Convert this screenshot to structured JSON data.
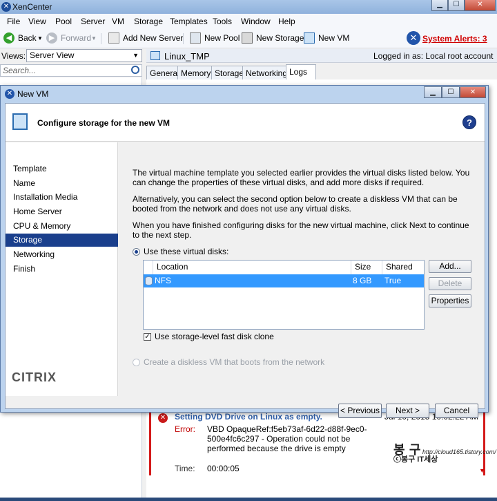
{
  "app": {
    "title": "XenCenter"
  },
  "menu": [
    "File",
    "View",
    "Pool",
    "Server",
    "VM",
    "Storage",
    "Templates",
    "Tools",
    "Window",
    "Help"
  ],
  "toolbar": {
    "back": "Back",
    "forward": "Forward",
    "add_server": "Add New Server",
    "new_pool": "New Pool",
    "new_storage": "New Storage",
    "new_vm": "New VM",
    "alerts": "System Alerts: 3"
  },
  "left": {
    "views_label": "Views:",
    "views_value": "Server View",
    "search_placeholder": "Search..."
  },
  "right": {
    "vm_name": "Linux_TMP",
    "logged_in": "Logged in as: Local root account",
    "tabs": [
      "General",
      "Memory",
      "Storage",
      "Networking",
      "Logs"
    ]
  },
  "log": {
    "title": "Setting DVD Drive on Linux as empty.",
    "timestamp": "Jul 10, 2015 10:02:22 AM",
    "error_label": "Error:",
    "error_text": "VBD OpaqueRef:f5eb73af-6d22-d88f-9ec0-500e4fc6c297 - Operation could not be performed because the drive is empty",
    "time_label": "Time:",
    "time_value": "00:00:05"
  },
  "watermark": {
    "big": "봉 구",
    "url": "http://cloud165.tistory.com/",
    "sub": "ⓒ봉구 IT세상"
  },
  "dialog": {
    "title": "New VM",
    "heading": "Configure storage for the new VM",
    "nav": [
      "Template",
      "Name",
      "Installation Media",
      "Home Server",
      "CPU & Memory",
      "Storage",
      "Networking",
      "Finish"
    ],
    "active_nav": "Storage",
    "logo": "CITRIX",
    "para1": "The virtual machine template you selected earlier provides the virtual disks listed below. You can change the properties of these virtual disks, and add more disks if required.",
    "para2": "Alternatively, you can select the second option below to create a diskless VM that can be booted from the network and does not use any virtual disks.",
    "para3": "When you have finished configuring disks for the new virtual machine, click Next to continue to the next step.",
    "option_disks": "Use these virtual disks:",
    "table_headers": {
      "location": "Location",
      "size": "Size",
      "shared": "Shared"
    },
    "disk": {
      "location": "NFS",
      "size": "8 GB",
      "shared": "True"
    },
    "btn_add": "Add...",
    "btn_delete": "Delete",
    "btn_properties": "Properties",
    "fast_clone": "Use storage-level fast disk clone",
    "option_diskless": "Create a diskless VM that boots from the network",
    "btn_previous": "< Previous",
    "btn_next": "Next >",
    "btn_cancel": "Cancel"
  }
}
